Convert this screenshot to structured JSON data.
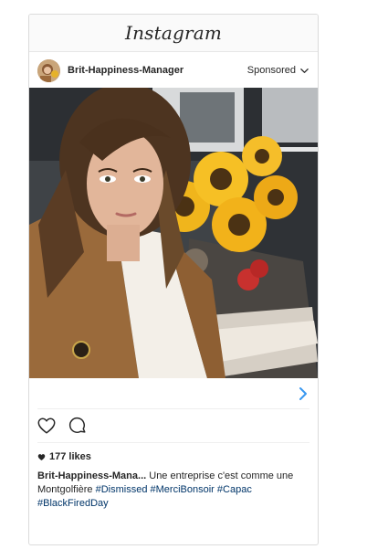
{
  "brand": {
    "logo_text": "Instagram"
  },
  "post": {
    "username": "Brit-Happiness-Manager",
    "sponsored_label": "Sponsored",
    "likes_label": "177 likes",
    "caption": {
      "username": "Brit-Happiness-Mana...",
      "text": "Une entreprise c'est comme une Montgolfière",
      "hashtags": [
        "#Dismissed",
        "#MerciBonsoir",
        "#Capac",
        "#BlackFiredDay"
      ]
    },
    "icons": {
      "sponsored_menu": "chevron-down-icon",
      "link": "chevron-right-icon",
      "like": "heart-outline-icon",
      "comment": "comment-bubble-icon",
      "likes_heart": "heart-filled-icon"
    },
    "colors": {
      "link_arrow": "#3897f0",
      "hashtag": "#003569"
    }
  }
}
